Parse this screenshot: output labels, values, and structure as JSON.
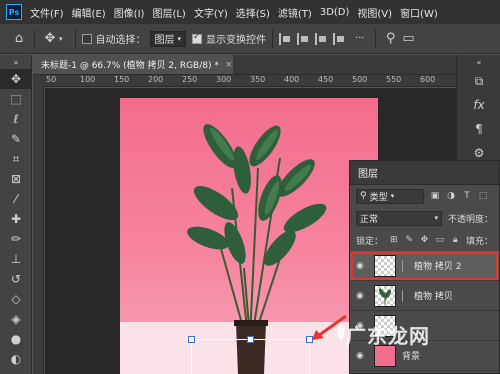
{
  "app": {
    "logo": "Ps"
  },
  "menu": [
    "文件(F)",
    "编辑(E)",
    "图像(I)",
    "图层(L)",
    "文字(Y)",
    "选择(S)",
    "滤镜(T)",
    "3D(D)",
    "视图(V)",
    "窗口(W)"
  ],
  "options_bar": {
    "auto_select_label": "自动选择：",
    "auto_select_value": "图层",
    "show_transform_label": "显示变换控件",
    "show_transform_checked": true
  },
  "document_tab": {
    "title": "未标题-1 @ 66.7% (植物 拷贝 2, RGB/8) *",
    "close": "×"
  },
  "rulers": {
    "h_ticks": [
      "50",
      "100",
      "150",
      "200",
      "250",
      "300",
      "350",
      "400",
      "450",
      "500",
      "550",
      "600"
    ]
  },
  "dock": {
    "icons": [
      "history-icon",
      "fx-icon",
      "paragraph-icon",
      "properties-icon"
    ]
  },
  "layers_panel": {
    "title": "图层",
    "filter_kind": "类型",
    "blend_mode": "正常",
    "opacity_label": "不透明度：",
    "lock_label": "锁定：",
    "fill_label": "填充：",
    "layers": [
      {
        "name": "植物 拷贝 2",
        "selected": true,
        "thumb": "transparent"
      },
      {
        "name": "植物 拷贝",
        "selected": false,
        "thumb": "plant"
      },
      {
        "name": "",
        "selected": false,
        "thumb": "transparent"
      },
      {
        "name": "背景",
        "selected": false,
        "thumb": "pink"
      }
    ]
  },
  "watermark": "广东龙网",
  "colors": {
    "accent_red": "#e8342d",
    "canvas_pink": "#f26c8d",
    "panel": "#4a4a4a"
  }
}
